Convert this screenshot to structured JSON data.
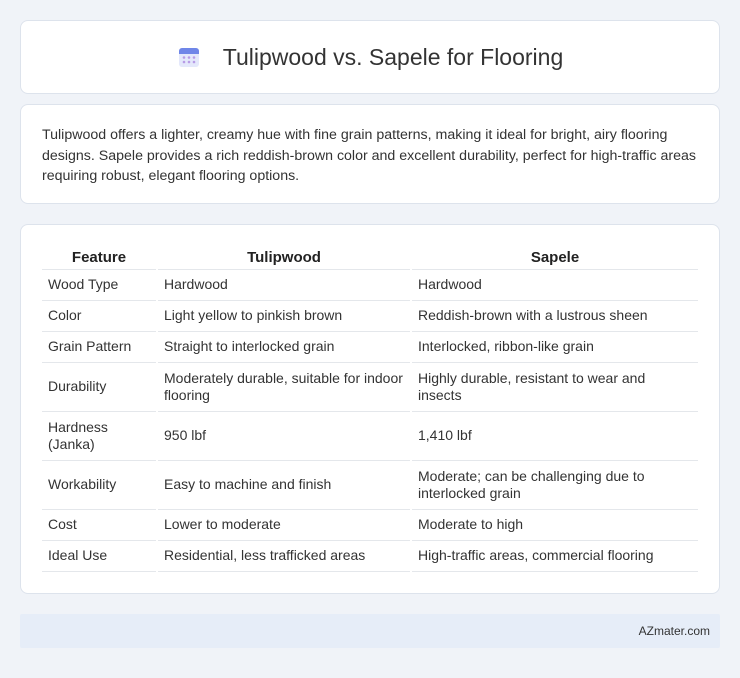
{
  "header": {
    "icon": "calendar-icon",
    "title": "Tulipwood vs. Sapele for Flooring"
  },
  "intro": "Tulipwood offers a lighter, creamy hue with fine grain patterns, making it ideal for bright, airy flooring designs. Sapele provides a rich reddish-brown color and excellent durability, perfect for high-traffic areas requiring robust, elegant flooring options.",
  "table": {
    "headers": [
      "Feature",
      "Tulipwood",
      "Sapele"
    ],
    "rows": [
      [
        "Wood Type",
        "Hardwood",
        "Hardwood"
      ],
      [
        "Color",
        "Light yellow to pinkish brown",
        "Reddish-brown with a lustrous sheen"
      ],
      [
        "Grain Pattern",
        "Straight to interlocked grain",
        "Interlocked, ribbon-like grain"
      ],
      [
        "Durability",
        "Moderately durable, suitable for indoor flooring",
        "Highly durable, resistant to wear and insects"
      ],
      [
        "Hardness (Janka)",
        "950 lbf",
        "1,410 lbf"
      ],
      [
        "Workability",
        "Easy to machine and finish",
        "Moderate; can be challenging due to interlocked grain"
      ],
      [
        "Cost",
        "Lower to moderate",
        "Moderate to high"
      ],
      [
        "Ideal Use",
        "Residential, less trafficked areas",
        "High-traffic areas, commercial flooring"
      ]
    ]
  },
  "footer": {
    "brand": "AZmater.com"
  }
}
